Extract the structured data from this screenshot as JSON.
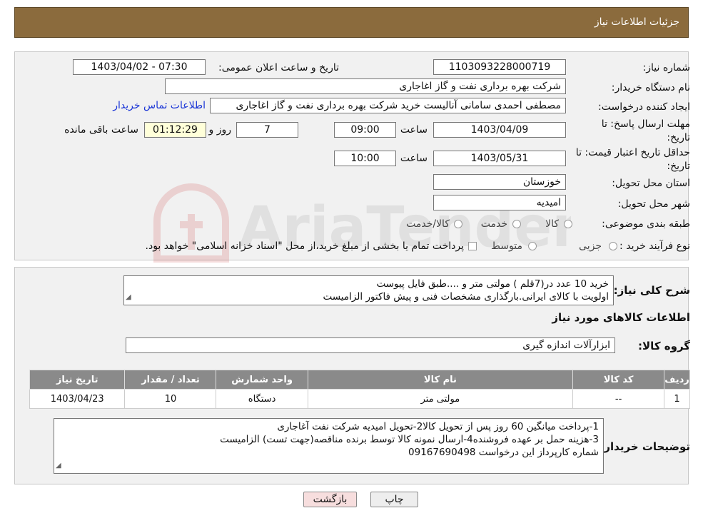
{
  "header": {
    "title": "جزئیات اطلاعات نیاز"
  },
  "info": {
    "need_number_label": "شماره نیاز:",
    "need_number": "1103093228000719",
    "announce_label": "تاریخ و ساعت اعلان عمومی:",
    "announce_value": "1403/04/02 - 07:30",
    "buyer_org_label": "نام دستگاه خریدار:",
    "buyer_org": "شرکت بهره برداری نفت و گاز اغاجاری",
    "creator_label": "ایجاد کننده درخواست:",
    "creator": "مصطفی احمدی سامانی آنالیست خرید شرکت بهره برداری نفت و گاز اغاجاری",
    "contact_link": "اطلاعات تماس خریدار",
    "deadline_label_1": "مهلت ارسال پاسخ: تا",
    "deadline_label_2": "تاریخ:",
    "deadline_date": "1403/04/09",
    "time_label": "ساعت",
    "deadline_time": "09:00",
    "days_value": "7",
    "days_label": "روز و",
    "remaining_time": "01:12:29",
    "remaining_label": "ساعت باقی مانده",
    "validity_label_1": "حداقل تاریخ اعتبار قیمت: تا",
    "validity_label_2": "تاریخ:",
    "validity_date": "1403/05/31",
    "validity_time": "10:00",
    "province_label": "استان محل تحویل:",
    "province": "خوزستان",
    "city_label": "شهر محل تحویل:",
    "city": "امیدیه",
    "category_label": "طبقه بندی موضوعی:",
    "category_options": [
      "کالا",
      "خدمت",
      "کالا/خدمت"
    ],
    "process_label": "نوع فرآیند خرید :",
    "process_options": [
      "جزیی",
      "متوسط"
    ],
    "process_note": "پرداخت تمام یا بخشی از مبلغ خرید،از محل \"اسناد خزانه اسلامی\" خواهد بود."
  },
  "summary": {
    "label": "شرح کلی نیاز:",
    "line1": "خرید 10 عدد در(7قلم ) مولتی متر و ....طبق فایل پیوست",
    "line2": "اولویت با کالای ایرانی.بارگذاری مشخصات فنی و پیش فاکتور الزامیست"
  },
  "goods": {
    "section_title": "اطلاعات کالاهای مورد نیاز",
    "group_label": "گروه کالا:",
    "group_value": "ابزارآلات اندازه گیری",
    "headers": [
      "ردیف",
      "کد کالا",
      "نام کالا",
      "واحد شمارش",
      "تعداد / مقدار",
      "تاریخ نیاز"
    ],
    "rows": [
      {
        "row": "1",
        "code": "--",
        "name": "مولتی متر",
        "unit": "دستگاه",
        "qty": "10",
        "date": "1403/04/23"
      }
    ]
  },
  "buyer_notes": {
    "label": "توضیحات خریدار:",
    "line1": "1-پرداخت میانگین 60 روز پس از تحویل کالا2-تحویل امیدیه شرکت نفت آغاجاری",
    "line2": "3-هزینه حمل بر عهده فروشنده4-ارسال نمونه کالا توسط برنده مناقصه(جهت تست) الزامیست",
    "line3": "شماره کارپرداز این درخواست 09167690498"
  },
  "buttons": {
    "print": "چاپ",
    "back": "بازگشت"
  },
  "watermark": {
    "text": "AriaTender.neT"
  },
  "colors": {
    "header_bg": "#8b6b3d",
    "table_header_bg": "#8a8a8a",
    "link": "#1a35d6",
    "back_button_bg": "#f7dede"
  }
}
